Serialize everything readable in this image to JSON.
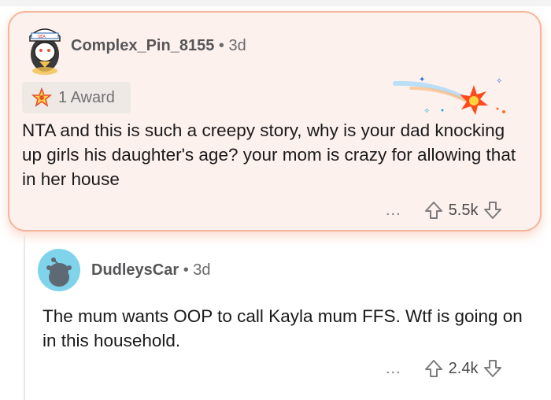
{
  "comment1": {
    "username": "Complex_Pin_8155",
    "age": "3d",
    "award_label": "1 Award",
    "body": "NTA and this is such a creepy story, why is your dad knocking up girls his daughter's age? your mom is crazy for allowing that in her house",
    "more": "...",
    "score": "5.5k"
  },
  "comment2": {
    "username": "DudleysCar",
    "age": "3d",
    "body": "The mum wants OOP to call Kayla mum FFS. Wtf is going on in this household.",
    "more": "...",
    "score": "2.4k"
  },
  "separator": "•",
  "colors": {
    "highlight_bg": "#fdf1ed",
    "highlight_border": "#f4b59a",
    "avatar2_bg": "#7fd3ea",
    "icon_gray": "#7c7c7e"
  },
  "icons": [
    "avatar-sailor",
    "award-star-icon",
    "firework-award-icon",
    "more-options-icon",
    "upvote-icon",
    "downvote-icon",
    "avatar-snoo"
  ]
}
